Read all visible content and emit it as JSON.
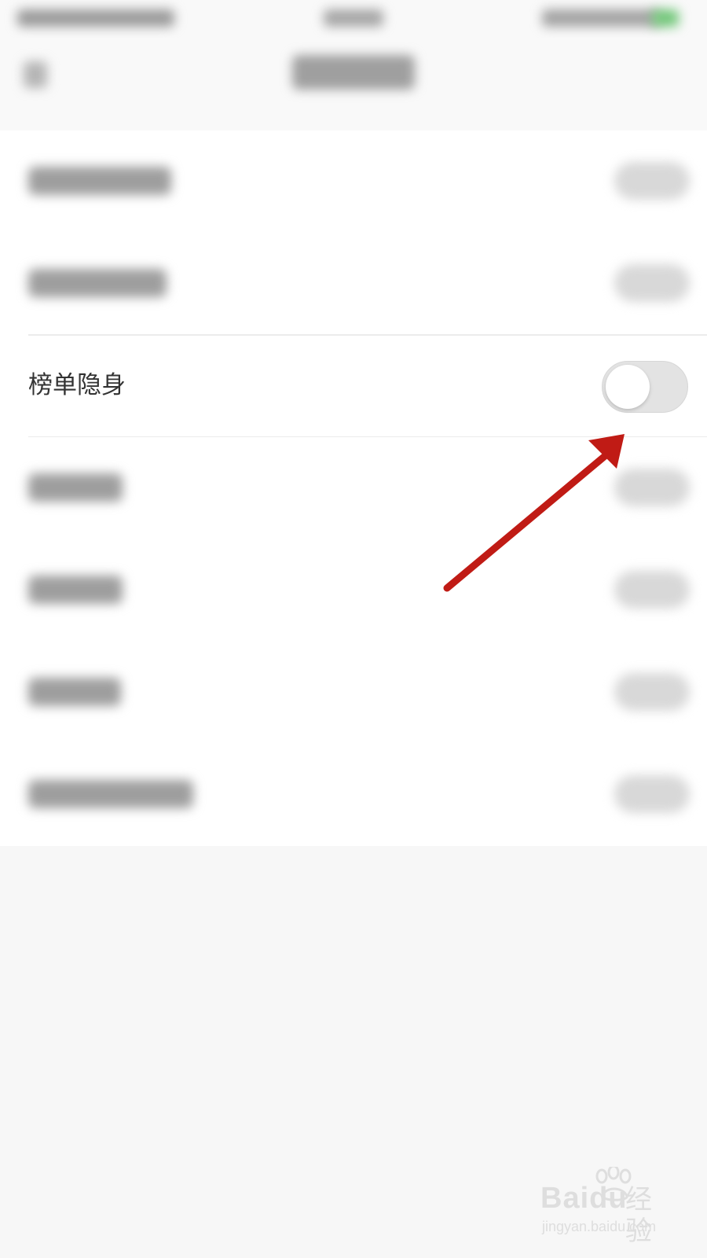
{
  "setting_row": {
    "label": "榜单隐身",
    "toggle_state": "off"
  },
  "annotation": {
    "arrow_color": "#c01b15"
  },
  "watermark": {
    "brand": "Baidu",
    "brand_cn": "经验",
    "url": "jingyan.baidu.com"
  },
  "colors": {
    "background": "#f7f7f7",
    "card": "#ffffff",
    "toggle_off_track": "#e3e3e3",
    "text": "#333333"
  }
}
